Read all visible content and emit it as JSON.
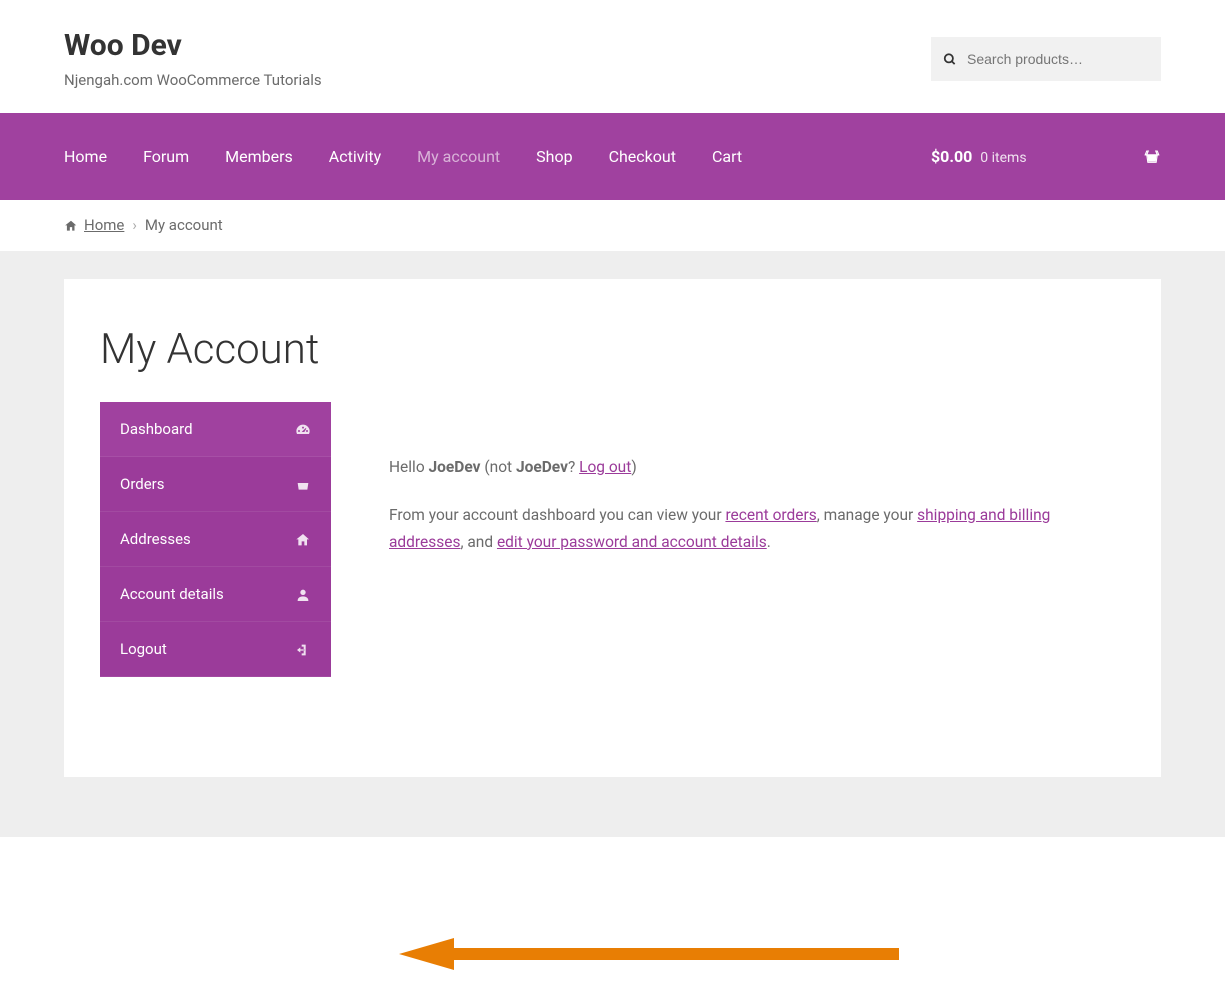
{
  "brand": {
    "title": "Woo Dev",
    "tagline": "Njengah.com WooCommerce Tutorials"
  },
  "search": {
    "placeholder": "Search products…"
  },
  "nav": {
    "items": [
      {
        "label": "Home",
        "active": false
      },
      {
        "label": "Forum",
        "active": false
      },
      {
        "label": "Members",
        "active": false
      },
      {
        "label": "Activity",
        "active": false
      },
      {
        "label": "My account",
        "active": true
      },
      {
        "label": "Shop",
        "active": false
      },
      {
        "label": "Checkout",
        "active": false
      },
      {
        "label": "Cart",
        "active": false
      }
    ],
    "cart": {
      "price": "$0.00",
      "items": "0 items"
    }
  },
  "breadcrumb": {
    "home": "Home",
    "current": "My account"
  },
  "page": {
    "heading": "My Account"
  },
  "accountNav": {
    "items": [
      {
        "label": "Dashboard",
        "icon": "dashboard",
        "active": true
      },
      {
        "label": "Orders",
        "icon": "basket",
        "active": false
      },
      {
        "label": "Addresses",
        "icon": "home",
        "active": false
      },
      {
        "label": "Account details",
        "icon": "user",
        "active": false
      },
      {
        "label": "Logout",
        "icon": "signout",
        "active": false
      }
    ]
  },
  "dashboard": {
    "greet_pre": "Hello ",
    "username": "JoeDev",
    "greet_mid": " (not ",
    "username2": "JoeDev",
    "greet_q": "? ",
    "logout": "Log out",
    "greet_close": ")",
    "line2_a": "From your account dashboard you can view your ",
    "link_orders": "recent orders",
    "line2_b": ", manage your ",
    "link_address": "shipping and billing addresses",
    "line2_c": ", and ",
    "link_account": "edit your password and account details",
    "line2_d": "."
  }
}
